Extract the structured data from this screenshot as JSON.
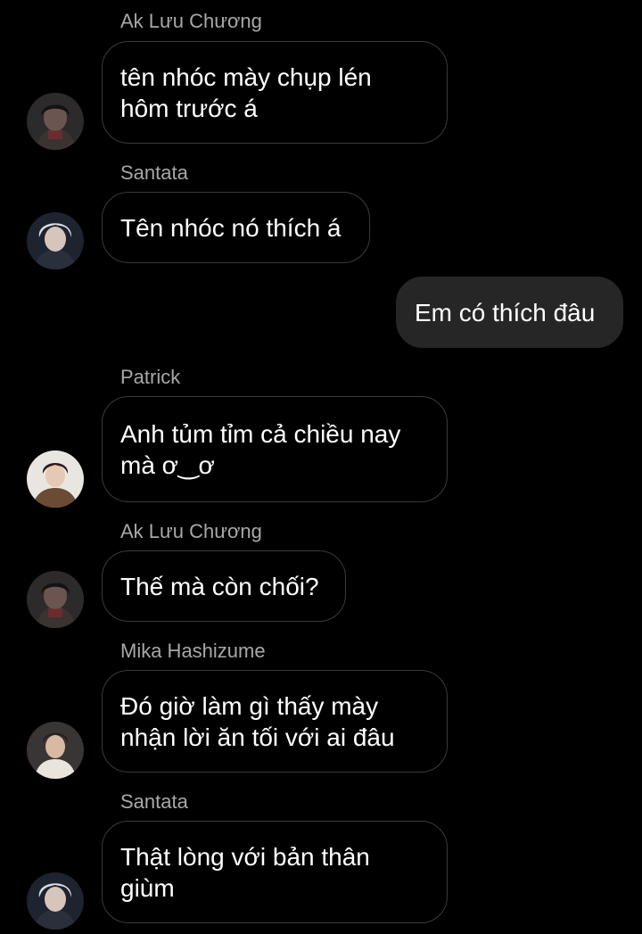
{
  "messages": [
    {
      "sender": "Ak Lưu Chương",
      "lines": [
        "tên nhóc mày chụp lén",
        "hôm trước á"
      ],
      "avatar": "avatar-ak-luu-chuong"
    },
    {
      "sender": "Santata",
      "lines": [
        "Tên nhóc nó thích á"
      ],
      "avatar": "avatar-santata"
    },
    {
      "sender": "",
      "lines": [
        "Em có thích đâu"
      ],
      "mine": true
    },
    {
      "sender": "Patrick",
      "lines": [
        "Anh tủm tỉm cả chiều nay",
        "mà ơ‿ơ"
      ],
      "avatar": "avatar-patrick"
    },
    {
      "sender": "Ak Lưu Chương",
      "lines": [
        "Thế mà còn chối?"
      ],
      "avatar": "avatar-ak-luu-chuong"
    },
    {
      "sender": "Mika Hashizume",
      "lines": [
        "Đó giờ làm gì thấy mày",
        "nhận lời ăn tối với ai đâu"
      ],
      "avatar": "avatar-mika-hashizume"
    },
    {
      "sender": "Santata",
      "lines": [
        "Thật lòng với bản thân",
        "giùm"
      ],
      "avatar": "avatar-santata"
    }
  ],
  "colors": {
    "background": "#000000",
    "bubble_border": "#3a3a3a",
    "own_bubble": "#262626",
    "sender_text": "#a8a8a8",
    "message_text": "#ffffff"
  }
}
